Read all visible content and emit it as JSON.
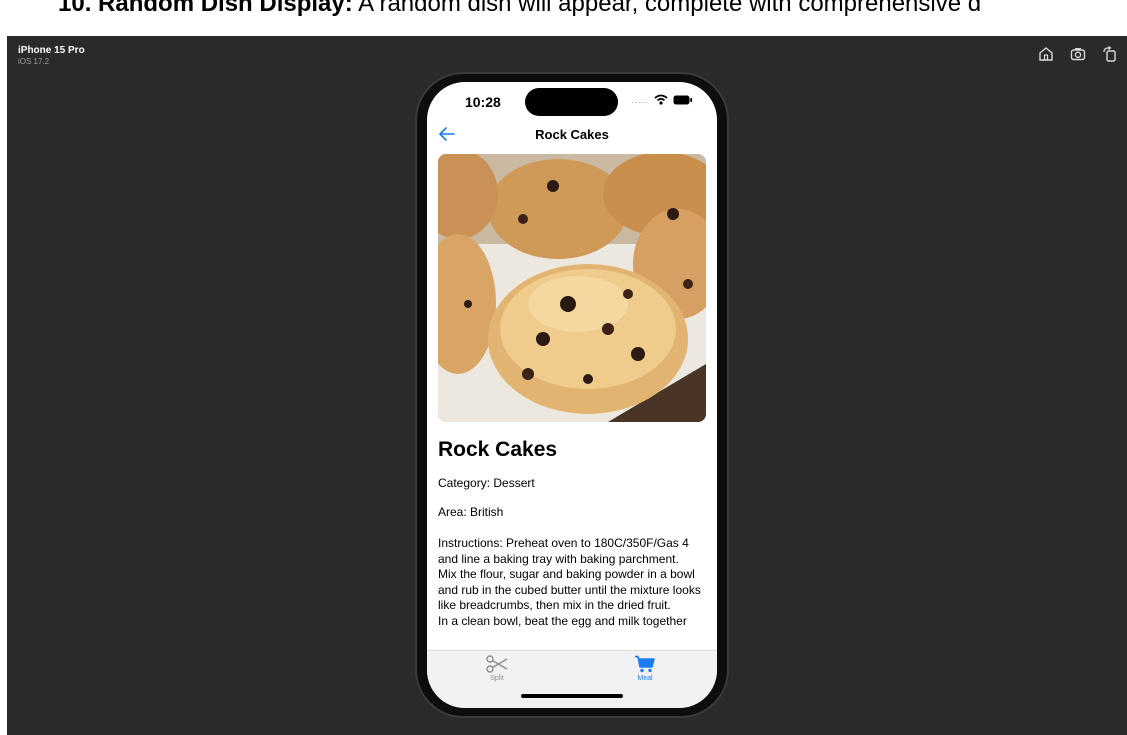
{
  "document": {
    "heading_bold": "10. Random Dish Display:",
    "heading_text": " A random dish will appear, complete with comprehensive d"
  },
  "simulator": {
    "device_name": "iPhone 15 Pro",
    "os_version": "iOS 17.2",
    "toolbar_icons": [
      "home-icon",
      "screenshot-icon",
      "rotate-icon"
    ]
  },
  "status_bar": {
    "time": "10:28",
    "signal_dots": "....."
  },
  "nav": {
    "title": "Rock Cakes"
  },
  "meal": {
    "name": "Rock Cakes",
    "category": "Category: Dessert",
    "area": "Area: British",
    "instructions": "Instructions: Preheat oven to 180C/350F/Gas 4 and line a baking tray with baking parchment.\nMix the flour, sugar and baking powder in a bowl and rub in the cubed butter until the mixture looks like breadcrumbs, then mix in the dried fruit.\nIn a clean bowl, beat the egg and milk together"
  },
  "tabbar": {
    "tabs": [
      {
        "label": "Split",
        "icon": "scissors-icon",
        "selected": false
      },
      {
        "label": "Meal",
        "icon": "cart-icon",
        "selected": true
      }
    ]
  },
  "colors": {
    "accent": "#1a7cf0",
    "simulator_bg": "#2a2a2a"
  }
}
